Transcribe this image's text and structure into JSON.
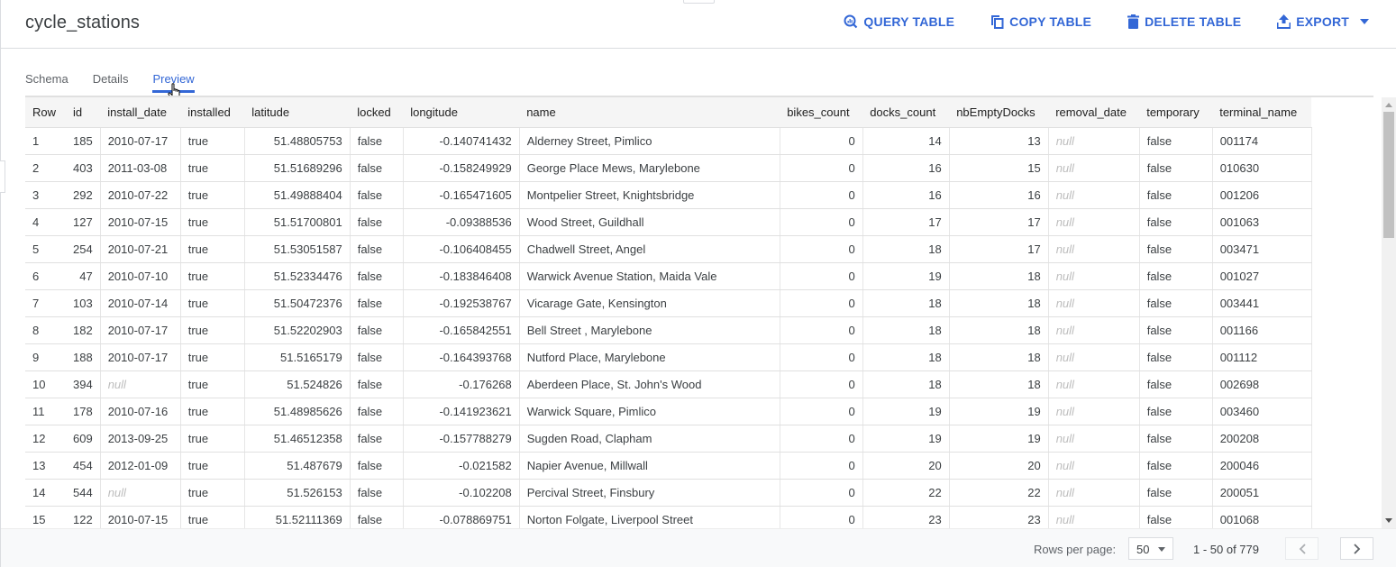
{
  "header": {
    "title": "cycle_stations",
    "actions": [
      {
        "label": "QUERY TABLE",
        "icon": "query-icon"
      },
      {
        "label": "COPY TABLE",
        "icon": "copy-icon"
      },
      {
        "label": "DELETE TABLE",
        "icon": "trash-icon"
      },
      {
        "label": "EXPORT",
        "icon": "upload-icon"
      }
    ]
  },
  "tabs": [
    {
      "label": "Schema",
      "active": false
    },
    {
      "label": "Details",
      "active": false
    },
    {
      "label": "Preview",
      "active": true
    }
  ],
  "accent_color": "#3367d6",
  "table": {
    "columns": [
      "Row",
      "id",
      "install_date",
      "installed",
      "latitude",
      "locked",
      "longitude",
      "name",
      "bikes_count",
      "docks_count",
      "nbEmptyDocks",
      "removal_date",
      "temporary",
      "terminal_name"
    ],
    "rows": [
      [
        "1",
        "185",
        "2010-07-17",
        "true",
        "51.48805753",
        "false",
        "-0.140741432",
        "Alderney Street, Pimlico",
        "0",
        "14",
        "13",
        "null",
        "false",
        "001174"
      ],
      [
        "2",
        "403",
        "2011-03-08",
        "true",
        "51.51689296",
        "false",
        "-0.158249929",
        "George Place Mews, Marylebone",
        "0",
        "16",
        "15",
        "null",
        "false",
        "010630"
      ],
      [
        "3",
        "292",
        "2010-07-22",
        "true",
        "51.49888404",
        "false",
        "-0.165471605",
        "Montpelier Street, Knightsbridge",
        "0",
        "16",
        "16",
        "null",
        "false",
        "001206"
      ],
      [
        "4",
        "127",
        "2010-07-15",
        "true",
        "51.51700801",
        "false",
        "-0.09388536",
        "Wood Street, Guildhall",
        "0",
        "17",
        "17",
        "null",
        "false",
        "001063"
      ],
      [
        "5",
        "254",
        "2010-07-21",
        "true",
        "51.53051587",
        "false",
        "-0.106408455",
        "Chadwell Street, Angel",
        "0",
        "18",
        "17",
        "null",
        "false",
        "003471"
      ],
      [
        "6",
        "47",
        "2010-07-10",
        "true",
        "51.52334476",
        "false",
        "-0.183846408",
        "Warwick Avenue Station, Maida Vale",
        "0",
        "19",
        "18",
        "null",
        "false",
        "001027"
      ],
      [
        "7",
        "103",
        "2010-07-14",
        "true",
        "51.50472376",
        "false",
        "-0.192538767",
        "Vicarage Gate, Kensington",
        "0",
        "18",
        "18",
        "null",
        "false",
        "003441"
      ],
      [
        "8",
        "182",
        "2010-07-17",
        "true",
        "51.52202903",
        "false",
        "-0.165842551",
        "Bell Street , Marylebone",
        "0",
        "18",
        "18",
        "null",
        "false",
        "001166"
      ],
      [
        "9",
        "188",
        "2010-07-17",
        "true",
        "51.5165179",
        "false",
        "-0.164393768",
        "Nutford Place, Marylebone",
        "0",
        "18",
        "18",
        "null",
        "false",
        "001112"
      ],
      [
        "10",
        "394",
        "null",
        "true",
        "51.524826",
        "false",
        "-0.176268",
        "Aberdeen Place, St. John's Wood",
        "0",
        "18",
        "18",
        "null",
        "false",
        "002698"
      ],
      [
        "11",
        "178",
        "2010-07-16",
        "true",
        "51.48985626",
        "false",
        "-0.141923621",
        "Warwick Square, Pimlico",
        "0",
        "19",
        "19",
        "null",
        "false",
        "003460"
      ],
      [
        "12",
        "609",
        "2013-09-25",
        "true",
        "51.46512358",
        "false",
        "-0.157788279",
        "Sugden Road, Clapham",
        "0",
        "19",
        "19",
        "null",
        "false",
        "200208"
      ],
      [
        "13",
        "454",
        "2012-01-09",
        "true",
        "51.487679",
        "false",
        "-0.021582",
        "Napier Avenue, Millwall",
        "0",
        "20",
        "20",
        "null",
        "false",
        "200046"
      ],
      [
        "14",
        "544",
        "null",
        "true",
        "51.526153",
        "false",
        "-0.102208",
        "Percival Street, Finsbury",
        "0",
        "22",
        "22",
        "null",
        "false",
        "200051"
      ],
      [
        "15",
        "122",
        "2010-07-15",
        "true",
        "51.52111369",
        "false",
        "-0.078869751",
        "Norton Folgate, Liverpool Street",
        "0",
        "23",
        "23",
        "null",
        "false",
        "001068"
      ]
    ]
  },
  "footer": {
    "rows_per_page_label": "Rows per page:",
    "rows_per_page_value": "50",
    "range_text": "1 - 50 of 779"
  }
}
